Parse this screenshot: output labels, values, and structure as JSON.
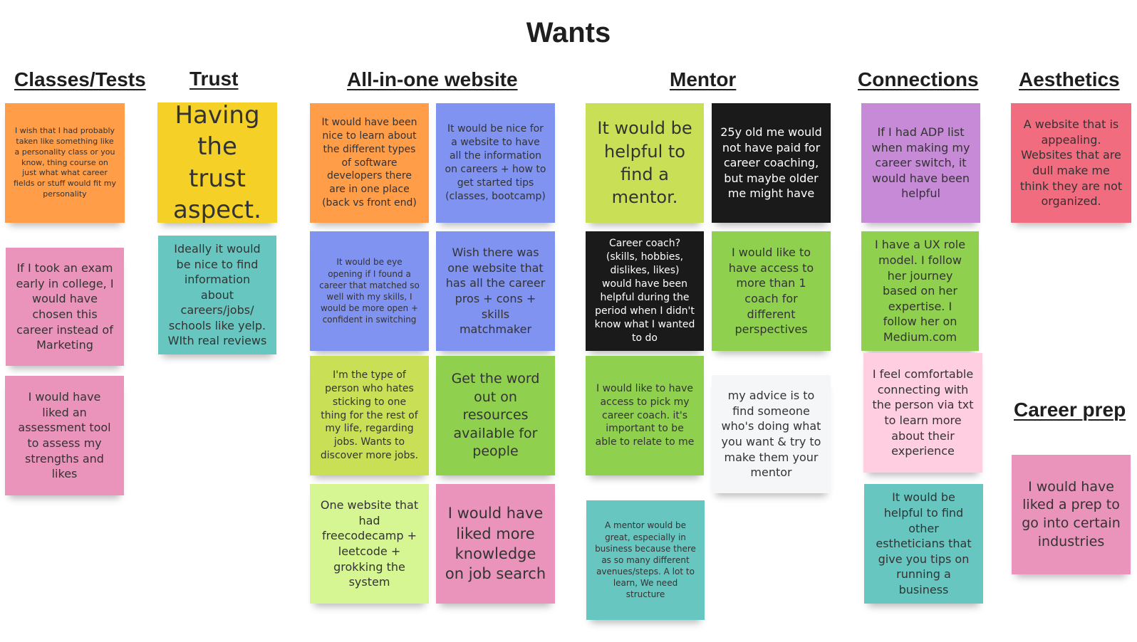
{
  "board": {
    "title": "Wants"
  },
  "headings": {
    "classes": "Classes/Tests",
    "trust": "Trust",
    "allinone": "All-in-one website",
    "mentor": "Mentor",
    "connections": "Connections",
    "aesthetics": "Aesthetics",
    "careerprep": "Career prep"
  },
  "notes": {
    "classes": [
      "I wish that I had probably taken like something like a personality class or you know, thing course on just what what career fields or stuff would fit my personality",
      "If I took an exam early in college, I would have chosen this career instead of Marketing",
      "I would have liked an assessment tool to assess my strengths and likes"
    ],
    "trust": [
      "Having the trust aspect.",
      "Ideally it would be nice to find information about careers/jobs/ schools like yelp. WIth real reviews"
    ],
    "allinone": [
      "It would have been nice to learn about the different types of software developers there are in one place (back vs front end)",
      "It would be nice for a website to have all the information on careers + how to get started tips (classes, bootcamp)",
      "It would be eye opening if I found a career that matched so well with my skills, I would be more open + confident in switching",
      "Wish there was one website that has all the career pros + cons + skills matchmaker",
      "I'm the type of person who hates sticking to one thing for the rest of my life, regarding jobs. Wants to discover more jobs.",
      "Get the word out on resources available for people",
      "One website that had freecodecamp + leetcode + grokking the system",
      "I would have liked more knowledge on job search"
    ],
    "mentor": [
      "It would be helpful to find a mentor.",
      "25y old me would not have paid for career coaching, but maybe older me might have",
      "Career coach? (skills, hobbies, dislikes, likes) would have been helpful during the period when I didn't know what I wanted to do",
      "I would like to have access to more than 1 coach for different perspectives",
      "I would like to have access to pick my career coach. it's important to be able to relate to me",
      "my advice is to find someone who's doing what you want & try to make them your mentor",
      "A mentor would be great, especially in business because there as so many different avenues/steps. A lot to learn, We need structure"
    ],
    "connections": [
      "If I had ADP list when making my career switch, it would have been helpful",
      "I have a UX role model. I follow her journey based on her expertise. I follow her on Medium.com",
      "I feel comfortable connecting with the person via txt to learn more about their experience",
      "It would be helpful to find other estheticians that give you tips on running a business"
    ],
    "aesthetics": [
      "A website that is appealing. Websites that are dull make me think they are not organized."
    ],
    "careerprep": [
      "I would have liked a prep to go into certain industries"
    ]
  },
  "colors": {
    "orange": "#ff9d48",
    "yellow": "#f5d128",
    "pink": "#ea94bb",
    "teal": "#67c6c0",
    "blue": "#8093f1",
    "lime": "#c9df56",
    "green": "#8fd14f",
    "light_green": "#d5f692",
    "black": "#1a1a1a",
    "white": "#f5f6f8",
    "violet": "#c78ad7",
    "red": "#f16c7f",
    "light_pink": "#ffcee0"
  }
}
